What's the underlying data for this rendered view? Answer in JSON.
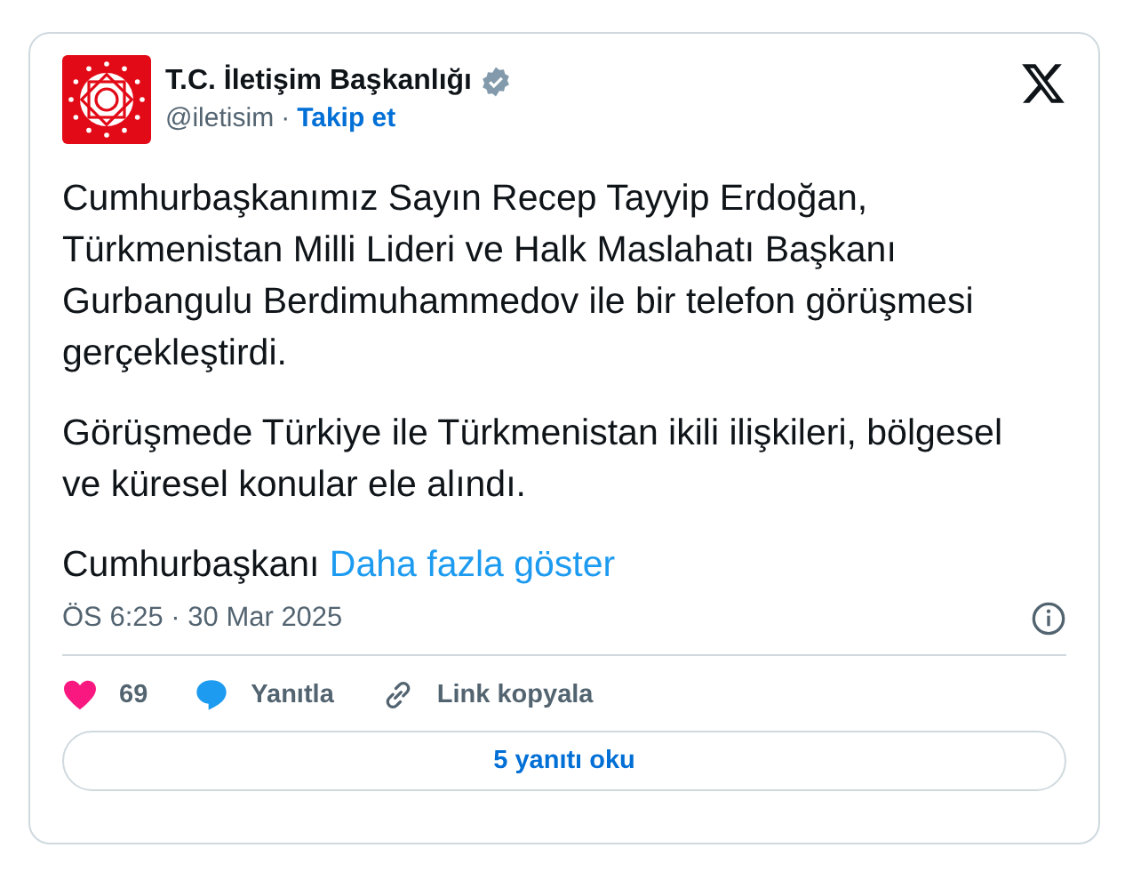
{
  "author": {
    "name": "T.C. İletişim Başkanlığı",
    "verified": true,
    "handle": "@iletisim",
    "separator": "·",
    "follow": "Takip et"
  },
  "paragraphs": [
    "Cumhurbaşkanımız Sayın Recep Tayyip Erdoğan, Türkmenistan Milli Lideri ve Halk Maslahatı Başkanı Gurbangulu Berdimuhammedov ile bir telefon görüşmesi gerçekleştirdi.",
    "Görüşmede Türkiye ile Türkmenistan ikili ilişkileri, bölgesel ve küresel konular ele alındı."
  ],
  "truncated": {
    "text": "Cumhurbaşkanı",
    "more": "Daha fazla göster"
  },
  "timestamp": "ÖS 6:25 · 30 Mar 2025",
  "actions": [
    {
      "kind": "like",
      "label": "69"
    },
    {
      "kind": "reply",
      "label": "Yanıtla"
    },
    {
      "kind": "link",
      "label": "Link kopyala"
    }
  ],
  "replies_button": "5 yanıtı oku"
}
